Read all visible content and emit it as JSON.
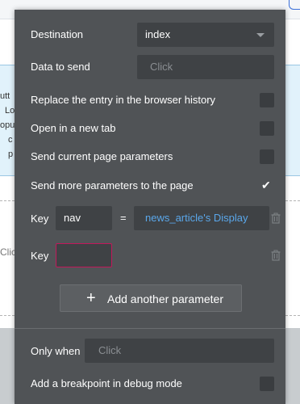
{
  "background": {
    "left_words": [
      "utt",
      "Lo",
      "opu",
      "c",
      "p"
    ],
    "clic_text": "Clic"
  },
  "form": {
    "destination": {
      "label": "Destination",
      "value": "index"
    },
    "data_to_send": {
      "label": "Data to send",
      "placeholder": "Click"
    },
    "replace_history": {
      "label": "Replace the entry in the browser history",
      "checked": false
    },
    "new_tab": {
      "label": "Open in a new tab",
      "checked": false
    },
    "send_current_params": {
      "label": "Send current page parameters",
      "checked": false
    },
    "send_more_params": {
      "label": "Send more parameters to the page",
      "checked": true,
      "checkmark": "✔"
    },
    "parameters": [
      {
        "key_label": "Key",
        "key_value": "nav",
        "equals": "=",
        "value": "news_article's Display"
      },
      {
        "key_label": "Key",
        "key_value": ""
      }
    ],
    "add_parameter": {
      "plus": "+",
      "label": "Add another parameter"
    },
    "only_when": {
      "label": "Only when",
      "placeholder": "Click"
    },
    "breakpoint": {
      "label": "Add a breakpoint in debug mode",
      "checked": false
    }
  },
  "colors": {
    "panel": "#505356",
    "field": "#3f4245",
    "expression_text": "#5aa7ea",
    "invalid_border": "#c2185b"
  }
}
